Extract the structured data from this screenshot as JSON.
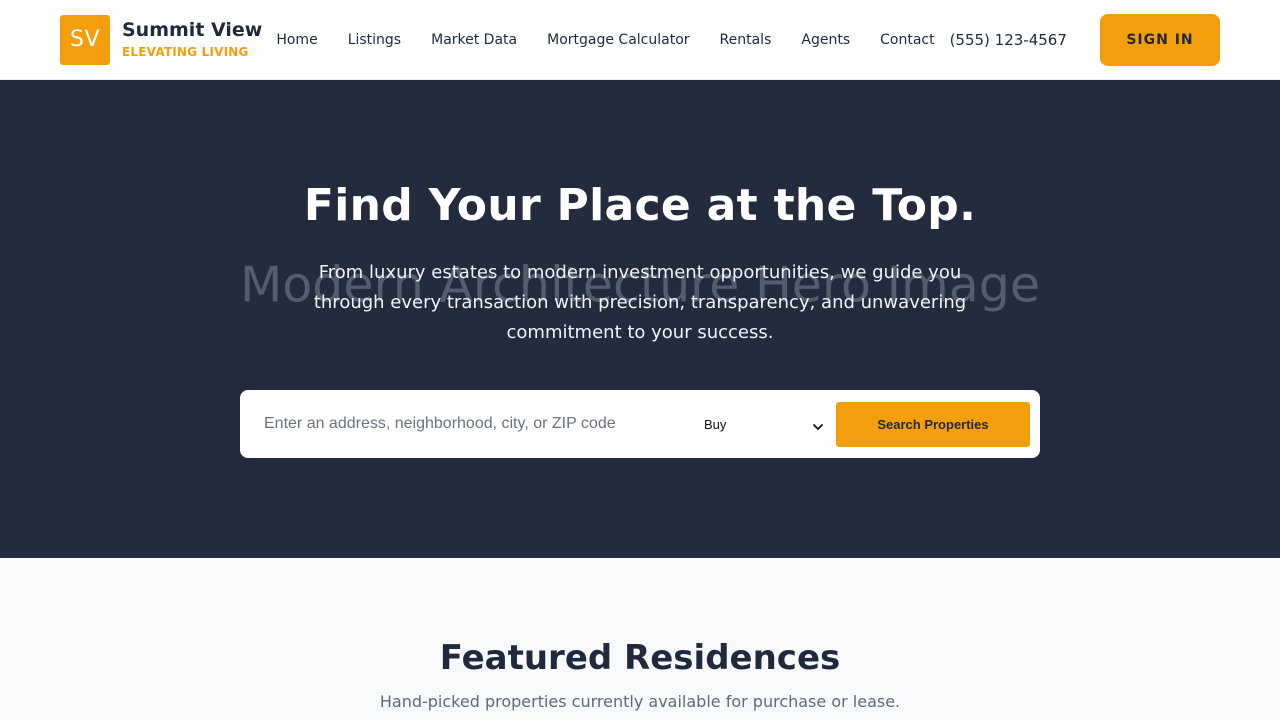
{
  "colors": {
    "accent": "#f59e0b",
    "navy": "#222c3e",
    "text_dark": "#1f2a3e",
    "background": "#f7f9fb"
  },
  "header": {
    "logo": {
      "initials": "SV",
      "name": "Summit View",
      "tagline": "ELEVATING LIVING"
    },
    "nav": [
      "Home",
      "Listings",
      "Market Data",
      "Mortgage Calculator",
      "Rentals",
      "Agents",
      "Contact"
    ],
    "phone": "(555) 123-4567",
    "signin_label": "SIGN IN"
  },
  "hero": {
    "placeholder_text": "Modern Architecture Hero Image",
    "title": "Find Your Place at the Top.",
    "subtitle": "From luxury estates to modern investment opportunities, we guide you through every transaction with precision, transparency, and unwavering commitment to your success.",
    "search": {
      "placeholder": "Enter an address, neighborhood, city, or ZIP code",
      "value": "",
      "type_selected": "Buy",
      "type_icon": "chevron-down-icon",
      "button_label": "Search Properties"
    }
  },
  "featured": {
    "title": "Featured Residences",
    "subtitle": "Hand-picked properties currently available for purchase or lease."
  }
}
